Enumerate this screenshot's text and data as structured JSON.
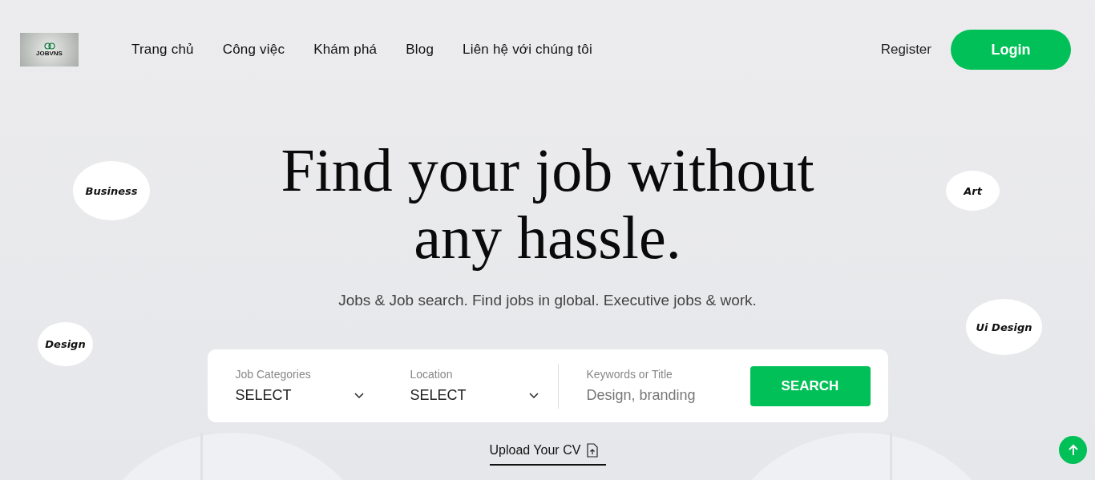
{
  "logo": {
    "text": "JOBVNS"
  },
  "nav": [
    {
      "label": "Trang chủ"
    },
    {
      "label": "Công việc"
    },
    {
      "label": "Khám phá"
    },
    {
      "label": "Blog"
    },
    {
      "label": "Liên hệ với chúng tôi"
    }
  ],
  "auth": {
    "register": "Register",
    "login": "Login"
  },
  "hero": {
    "title_line_1": "Find your job without",
    "title_line_2": "any hassle.",
    "subtitle": "Jobs & Job search. Find jobs in global. Executive jobs & work."
  },
  "tags": [
    {
      "label": "Business"
    },
    {
      "label": "Design"
    },
    {
      "label": "Art"
    },
    {
      "label": "Ui Design"
    }
  ],
  "search": {
    "fields": [
      {
        "kind": "select",
        "label": "Job Categories",
        "value": "SELECT"
      },
      {
        "kind": "select",
        "label": "Location",
        "value": "SELECT"
      },
      {
        "kind": "text",
        "label": "Keywords or Title",
        "placeholder": "Design, branding"
      }
    ],
    "button": "SEARCH"
  },
  "upload": {
    "label": "Upload Your CV"
  }
}
